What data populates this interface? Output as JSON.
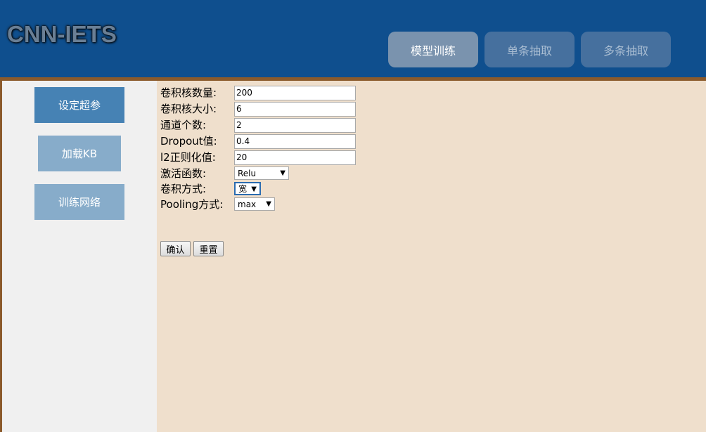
{
  "app": {
    "logo_text": "CNN-IETS"
  },
  "header": {
    "tabs": [
      {
        "label": "模型训练",
        "active": true
      },
      {
        "label": "单条抽取",
        "active": false
      },
      {
        "label": "多条抽取",
        "active": false
      }
    ]
  },
  "sidebar": {
    "items": [
      {
        "label": "设定超参",
        "active": true
      },
      {
        "label": "加载KB",
        "active": false
      },
      {
        "label": "训练网络",
        "active": false
      }
    ]
  },
  "form": {
    "kernel_count": {
      "label": "卷积核数量:",
      "value": "200"
    },
    "kernel_size": {
      "label": "卷积核大小:",
      "value": "6"
    },
    "channels": {
      "label": "通道个数:",
      "value": "2"
    },
    "dropout": {
      "label": "Dropout值:",
      "value": "0.4"
    },
    "l2": {
      "label": "l2正则化值:",
      "value": "20"
    },
    "activation": {
      "label": "激活函数:",
      "selected": "Relu"
    },
    "conv_mode": {
      "label": "卷积方式:",
      "selected": "宽"
    },
    "pooling": {
      "label": "Pooling方式:",
      "selected": "max"
    }
  },
  "actions": {
    "confirm_label": "确认",
    "reset_label": "重置"
  },
  "colors": {
    "header_bg": "#0f4f8e",
    "frame_border": "#8b5a2b",
    "main_bg": "#efdfcc",
    "sidebar_bg": "#f0f0f0",
    "sidebar_active": "#4682b4",
    "sidebar_inactive": "#87acca"
  },
  "icons": {
    "dropdown_arrow": "dropdown-arrow-icon"
  }
}
